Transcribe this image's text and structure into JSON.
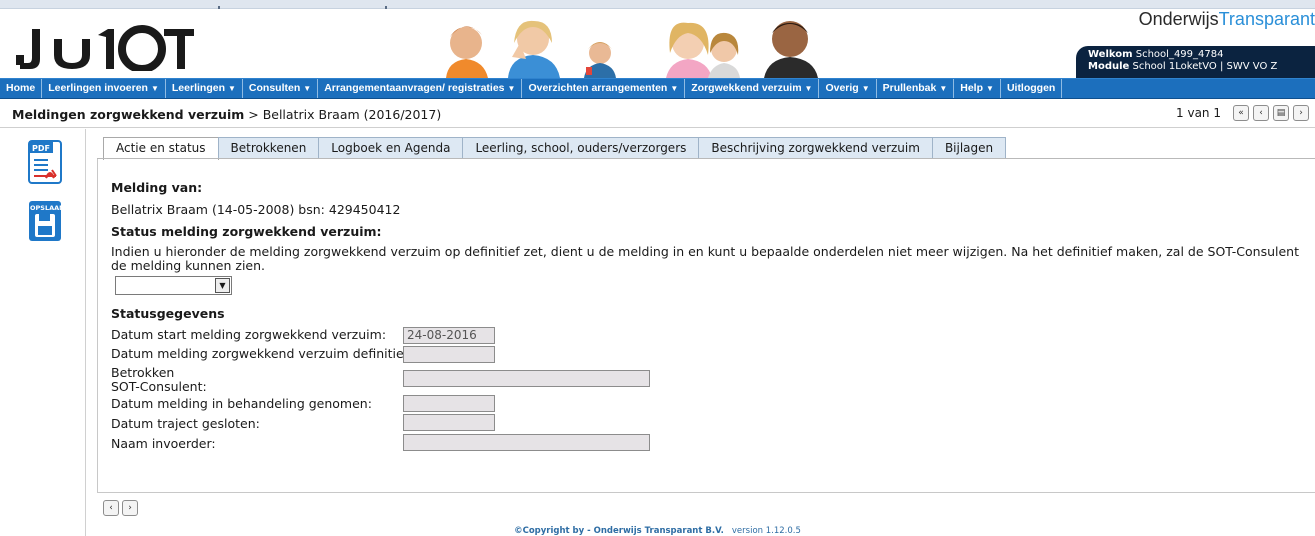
{
  "header": {
    "logo_text": "1LOKET",
    "brand_prefix": "Onderwijs",
    "brand_suffix": "Transparant",
    "welcome_label": "Welkom",
    "welcome_value": "School_499_4784",
    "module_label": "Module",
    "module_value": "School 1LoketVO | SWV VO Z"
  },
  "nav": {
    "items": [
      {
        "label": "Home",
        "dropdown": false
      },
      {
        "label": "Leerlingen invoeren",
        "dropdown": true
      },
      {
        "label": "Leerlingen",
        "dropdown": true
      },
      {
        "label": "Consulten",
        "dropdown": true
      },
      {
        "label": "Arrangementaanvragen/ registraties",
        "dropdown": true
      },
      {
        "label": "Overzichten arrangementen",
        "dropdown": true
      },
      {
        "label": "Zorgwekkend verzuim",
        "dropdown": true
      },
      {
        "label": "Overig",
        "dropdown": true
      },
      {
        "label": "Prullenbak",
        "dropdown": true
      },
      {
        "label": "Help",
        "dropdown": true
      },
      {
        "label": "Uitloggen",
        "dropdown": false
      }
    ]
  },
  "breadcrumb": {
    "section": "Meldingen zorgwekkend verzuim",
    "separator": " > ",
    "current": "Bellatrix Braam (2016/2017)"
  },
  "pager": {
    "text": "1 van 1"
  },
  "rail": {
    "pdf_label": "PDF",
    "save_label": "OPSLAAN"
  },
  "tabs": [
    {
      "label": "Actie en status",
      "active": true
    },
    {
      "label": "Betrokkenen",
      "active": false
    },
    {
      "label": "Logboek en Agenda",
      "active": false
    },
    {
      "label": "Leerling, school, ouders/verzorgers",
      "active": false
    },
    {
      "label": "Beschrijving zorgwekkend verzuim",
      "active": false
    },
    {
      "label": "Bijlagen",
      "active": false
    }
  ],
  "form": {
    "melding_title": "Melding van:",
    "melding_value": "Bellatrix Braam (14-05-2008) bsn: 429450412",
    "status_title": "Status melding zorgwekkend verzuim:",
    "status_text": "Indien u hieronder de melding zorgwekkend verzuim op definitief zet, dient u de melding in en kunt u bepaalde onderdelen niet meer wijzigen. Na het definitief maken, zal de SOT-Consulent de melding kunnen zien.",
    "status_select_value": "",
    "statusgegevens_title": "Statusgegevens",
    "fields": [
      {
        "label": "Datum start melding zorgwekkend verzuim:",
        "value": "24-08-2016"
      },
      {
        "label": "Datum melding zorgwekkend verzuim definitief:",
        "value": ""
      },
      {
        "label_line1": "Betrokken",
        "label_line2": "SOT-Consulent:",
        "value": ""
      },
      {
        "label": "Datum melding in behandeling genomen:",
        "value": ""
      },
      {
        "label": "Datum traject gesloten:",
        "value": ""
      },
      {
        "label": "Naam invoerder:",
        "value": ""
      }
    ]
  },
  "footer": {
    "copyright": "©Copyright by - Onderwijs Transparant B.V.",
    "version": "version 1.12.0.5"
  },
  "colors": {
    "nav_bg": "#1c6fbd",
    "welcome_bg": "#0b2340",
    "brand_accent": "#2a8fd8",
    "tab_bg": "#dde8f3",
    "field_bg": "#e6e3e6"
  }
}
